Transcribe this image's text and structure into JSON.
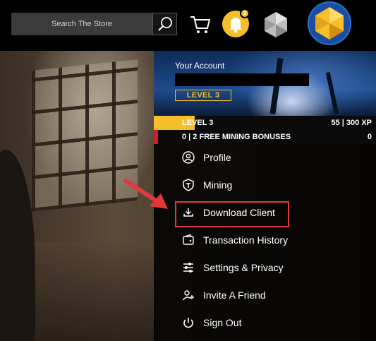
{
  "header": {
    "search": {
      "placeholder": "Search The Store"
    },
    "icons": {
      "search": "search-icon",
      "cart": "cart-icon",
      "notifications": "bell-icon",
      "gem": "gem-icon",
      "avatar": "avatar-badge"
    },
    "notification_count": "1"
  },
  "account": {
    "title": "Your Account",
    "level_badge": "LEVEL 3",
    "progress": {
      "level_label": "LEVEL 3",
      "xp_label": "55 | 300 XP",
      "xp_fraction": 0.183
    },
    "mining": {
      "label": "0 | 2 FREE MINING BONUSES",
      "count": "0",
      "fraction": 0
    }
  },
  "menu": {
    "items": [
      {
        "label": "Profile",
        "icon": "user-icon"
      },
      {
        "label": "Mining",
        "icon": "shield-icon"
      },
      {
        "label": "Download Client",
        "icon": "download-icon"
      },
      {
        "label": "Transaction History",
        "icon": "wallet-icon"
      },
      {
        "label": "Settings & Privacy",
        "icon": "sliders-icon"
      },
      {
        "label": "Invite A Friend",
        "icon": "add-user-icon"
      },
      {
        "label": "Sign Out",
        "icon": "power-icon"
      }
    ]
  },
  "colors": {
    "accent_gold": "#f6bf29",
    "accent_red": "#e2383b",
    "bonus_red": "#c9202a"
  }
}
